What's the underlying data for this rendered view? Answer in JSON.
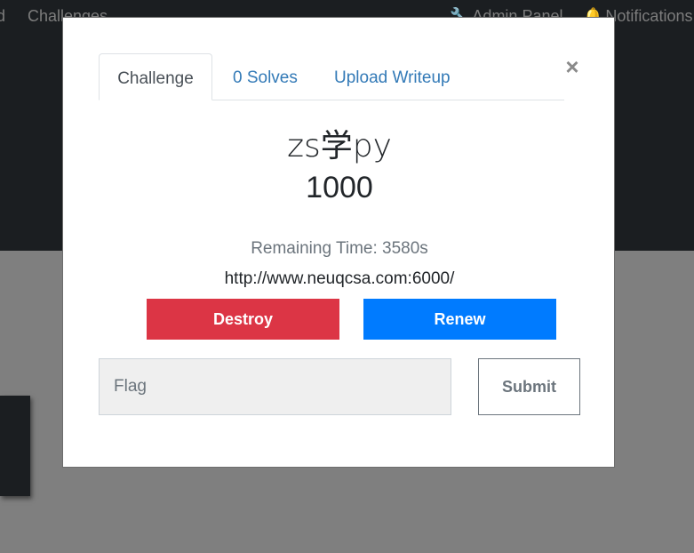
{
  "navbar": {
    "brand_fragment": "d",
    "challenges_label": "Challenges",
    "admin_icon": "wrench-icon",
    "admin_label": "Admin Panel",
    "notif_icon": "bell-icon",
    "notif_label": "Notifications"
  },
  "modal": {
    "tabs": [
      {
        "label": "Challenge",
        "active": true
      },
      {
        "label": "0 Solves",
        "active": false
      },
      {
        "label": "Upload Writeup",
        "active": false
      }
    ],
    "close_symbol": "×",
    "challenge_name": "zs学py",
    "challenge_value": "1000",
    "remaining_time": "Remaining Time: 3580s",
    "url": "http://www.neuqcsa.com:6000/",
    "destroy_label": "Destroy",
    "renew_label": "Renew",
    "flag_placeholder": "Flag",
    "submit_label": "Submit"
  },
  "colors": {
    "destroy": "#dc3545",
    "renew": "#007bff",
    "link": "#337ab7",
    "overlay": "#7f7f7f"
  }
}
